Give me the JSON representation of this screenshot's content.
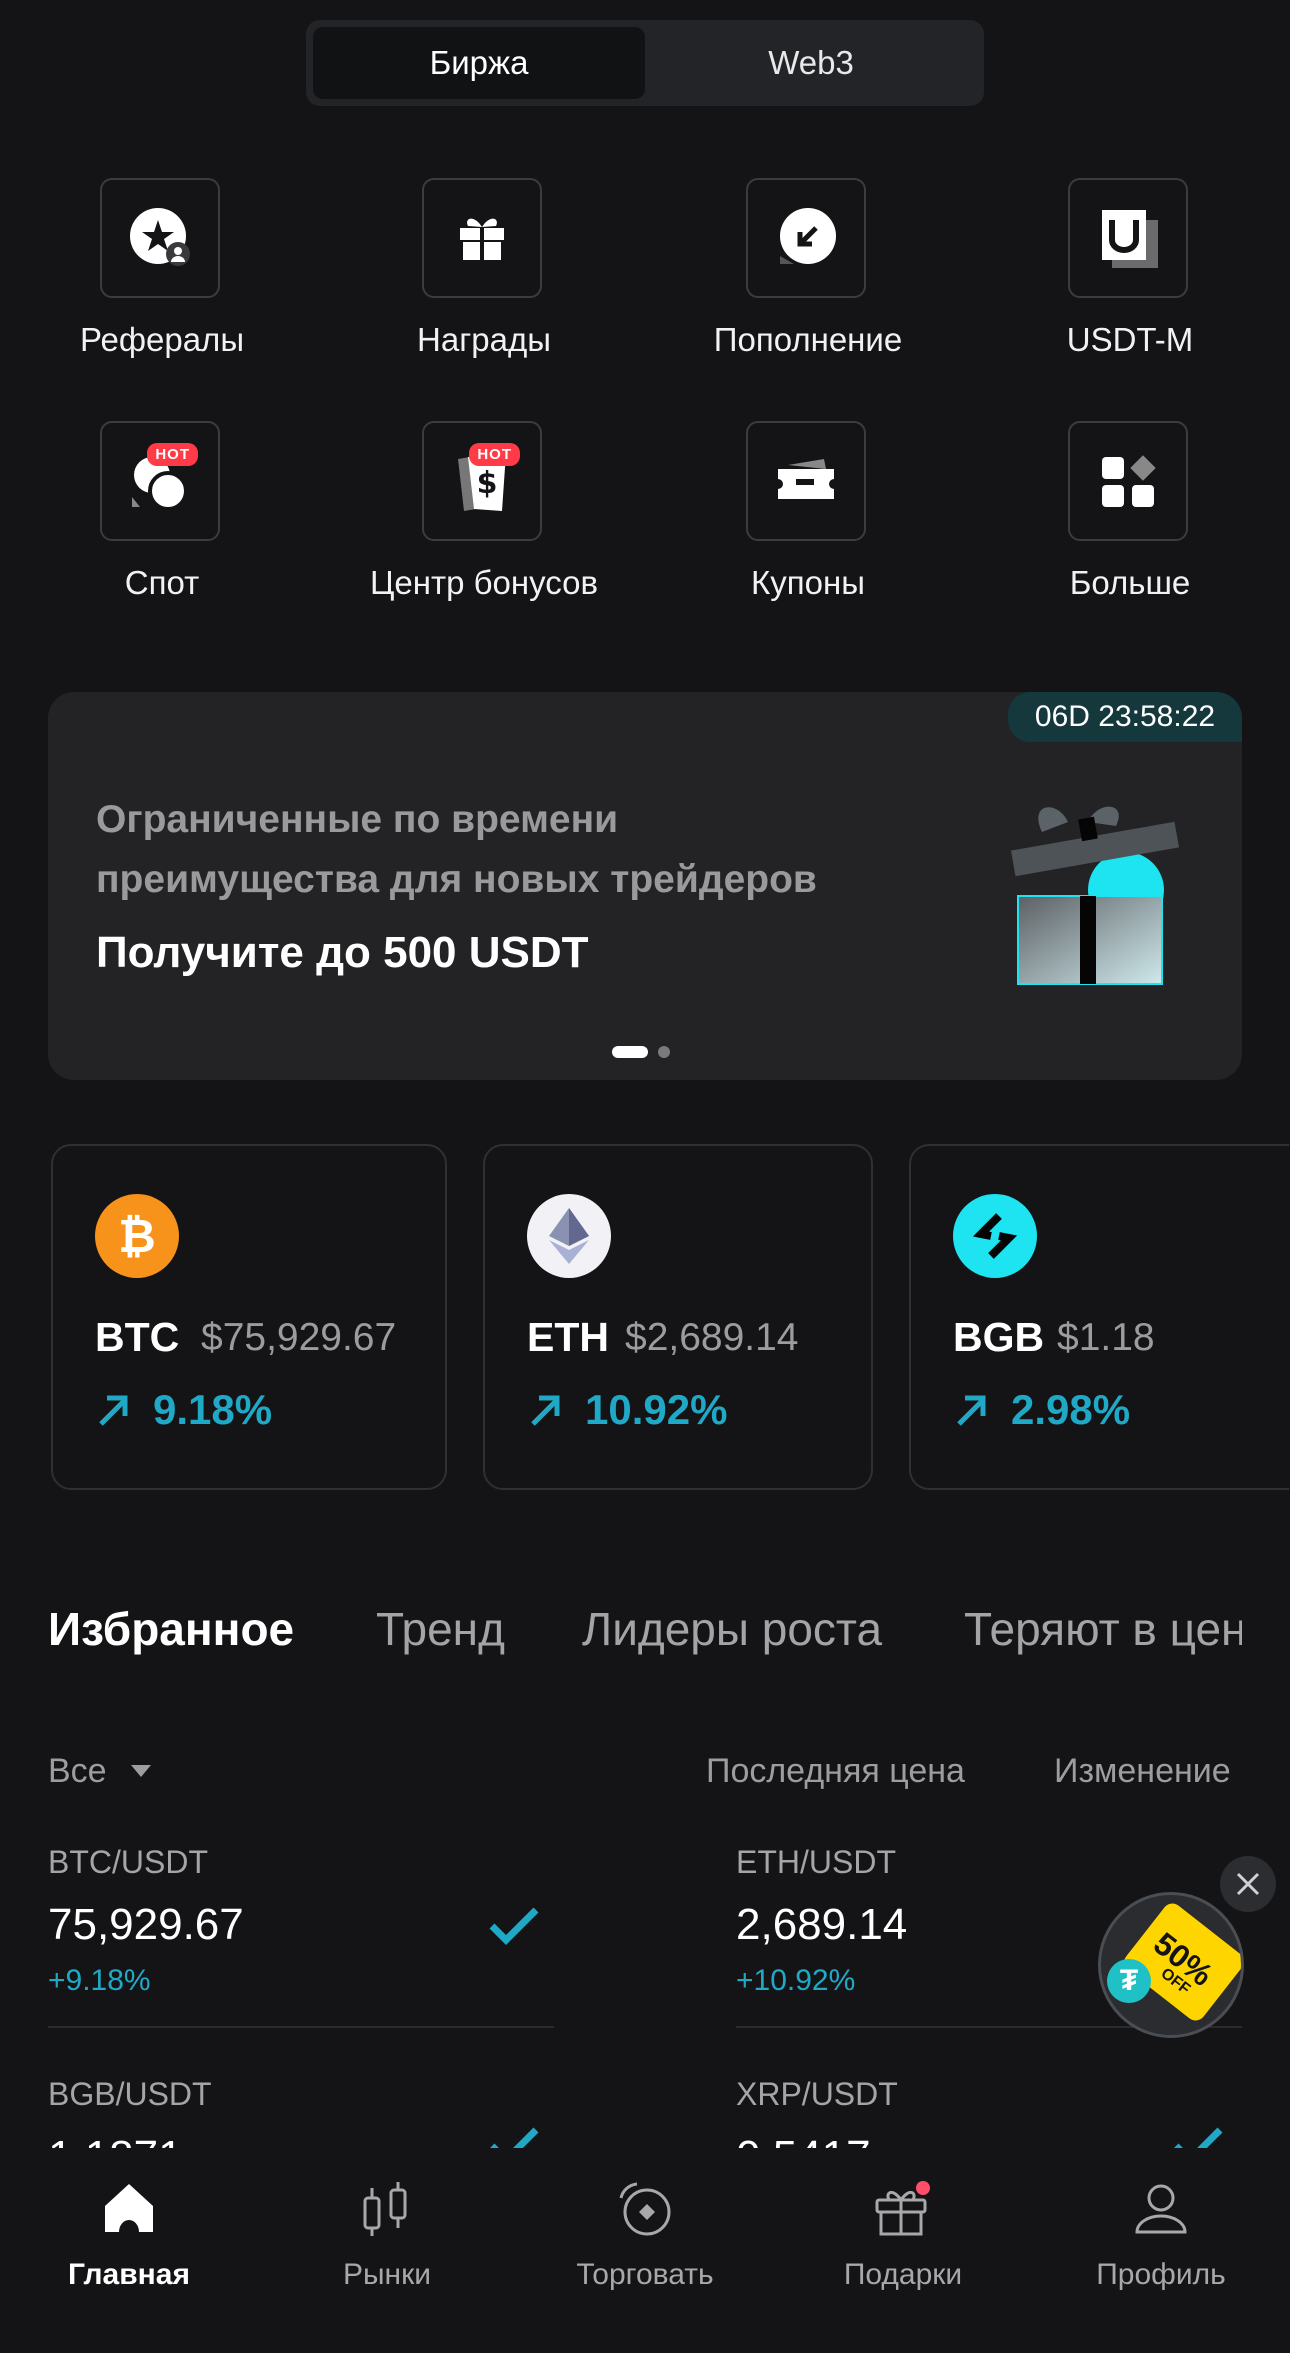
{
  "segment": {
    "left": "Биржа",
    "right": "Web3"
  },
  "shortcuts": [
    {
      "label": "Рефералы",
      "icon": "referral-star-icon",
      "hot": false
    },
    {
      "label": "Награды",
      "icon": "gift-icon",
      "hot": false
    },
    {
      "label": "Пополнение",
      "icon": "deposit-arrow-icon",
      "hot": false
    },
    {
      "label": "USDT-M",
      "icon": "usdt-m-icon",
      "hot": false
    },
    {
      "label": "Спот",
      "icon": "spot-icon",
      "hot": true
    },
    {
      "label": "Центр бонусов",
      "icon": "bonus-ticket-icon",
      "hot": true
    },
    {
      "label": "Купоны",
      "icon": "coupon-icon",
      "hot": false
    },
    {
      "label": "Больше",
      "icon": "more-grid-icon",
      "hot": false
    }
  ],
  "hot_badge": "HOT",
  "banner": {
    "timer": "06D 23:58:22",
    "line1": "Ограниченные по времени",
    "line2": "преимущества для новых трейдеров",
    "headline": "Получите до 500 USDT"
  },
  "coins": [
    {
      "symbol": "BTC",
      "price": "$75,929.67",
      "change": "9.18%",
      "color": "#f7931a"
    },
    {
      "symbol": "ETH",
      "price": "$2,689.14",
      "change": "10.92%",
      "color": "#e8e8f0"
    },
    {
      "symbol": "BGB",
      "price": "$1.18",
      "change": "2.98%",
      "color": "#1de4f0"
    }
  ],
  "tabs": [
    "Избранное",
    "Тренд",
    "Лидеры роста",
    "Теряют в цен"
  ],
  "list_header": {
    "filter": "Все",
    "last_price": "Последняя цена",
    "change": "Изменение"
  },
  "favorites": [
    {
      "pair": "BTC/USDT",
      "price": "75,929.67",
      "change": "+9.18%"
    },
    {
      "pair": "ETH/USDT",
      "price": "2,689.14",
      "change": "+10.92%"
    },
    {
      "pair": "BGB/USDT",
      "price": "1.1871",
      "change": ""
    },
    {
      "pair": "XRP/USDT",
      "price": "0.5417",
      "change": ""
    }
  ],
  "promo": {
    "text": "50%",
    "sub": "OFF"
  },
  "nav": [
    {
      "label": "Главная",
      "icon": "home-icon"
    },
    {
      "label": "Рынки",
      "icon": "markets-icon"
    },
    {
      "label": "Торговать",
      "icon": "trade-icon"
    },
    {
      "label": "Подарки",
      "icon": "gifts-icon"
    },
    {
      "label": "Профиль",
      "icon": "profile-icon"
    }
  ],
  "colors": {
    "accent": "#20a9c6",
    "background": "#141416",
    "hot": "#ff3b47"
  }
}
